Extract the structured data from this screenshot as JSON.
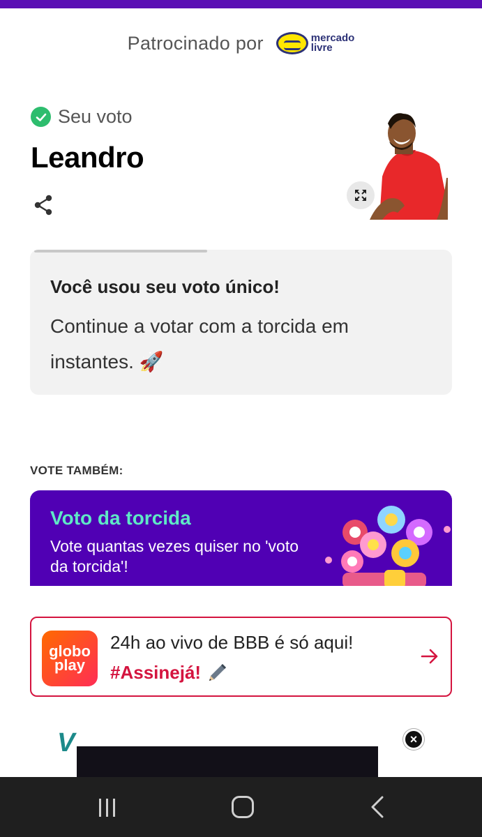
{
  "sponsor": {
    "label": "Patrocinado por",
    "logo_line1": "mercado",
    "logo_line2": "livre"
  },
  "vote": {
    "status_label": "Seu voto",
    "candidate": "Leandro"
  },
  "info_card": {
    "title": "Você usou seu voto único!",
    "body": "Continue a votar com a torcida em instantes. 🚀",
    "progress": 0.41
  },
  "vote_also": {
    "label": "VOTE TAMBÉM:"
  },
  "torcida": {
    "title": "Voto da torcida",
    "description": "Vote quantas vezes quiser no 'voto da torcida'!"
  },
  "globoplay": {
    "logo_line1": "globo",
    "logo_line2": "play",
    "line1": "24h ao vivo de BBB é só aqui!",
    "line2": "#Assinejá!"
  },
  "ad": {
    "logo_letter": "V"
  },
  "colors": {
    "top_bar": "#5a0fb4",
    "accent_purple": "#5000b4",
    "accent_green": "#5fe8c6",
    "accent_red": "#d4143f",
    "check_green": "#2dbd6e"
  },
  "icons": [
    "check-icon",
    "share-icon",
    "expand-icon",
    "rocket-icon",
    "arrow-right-icon",
    "pencil-icon",
    "close-icon",
    "recent-apps-icon",
    "home-icon",
    "back-icon"
  ]
}
